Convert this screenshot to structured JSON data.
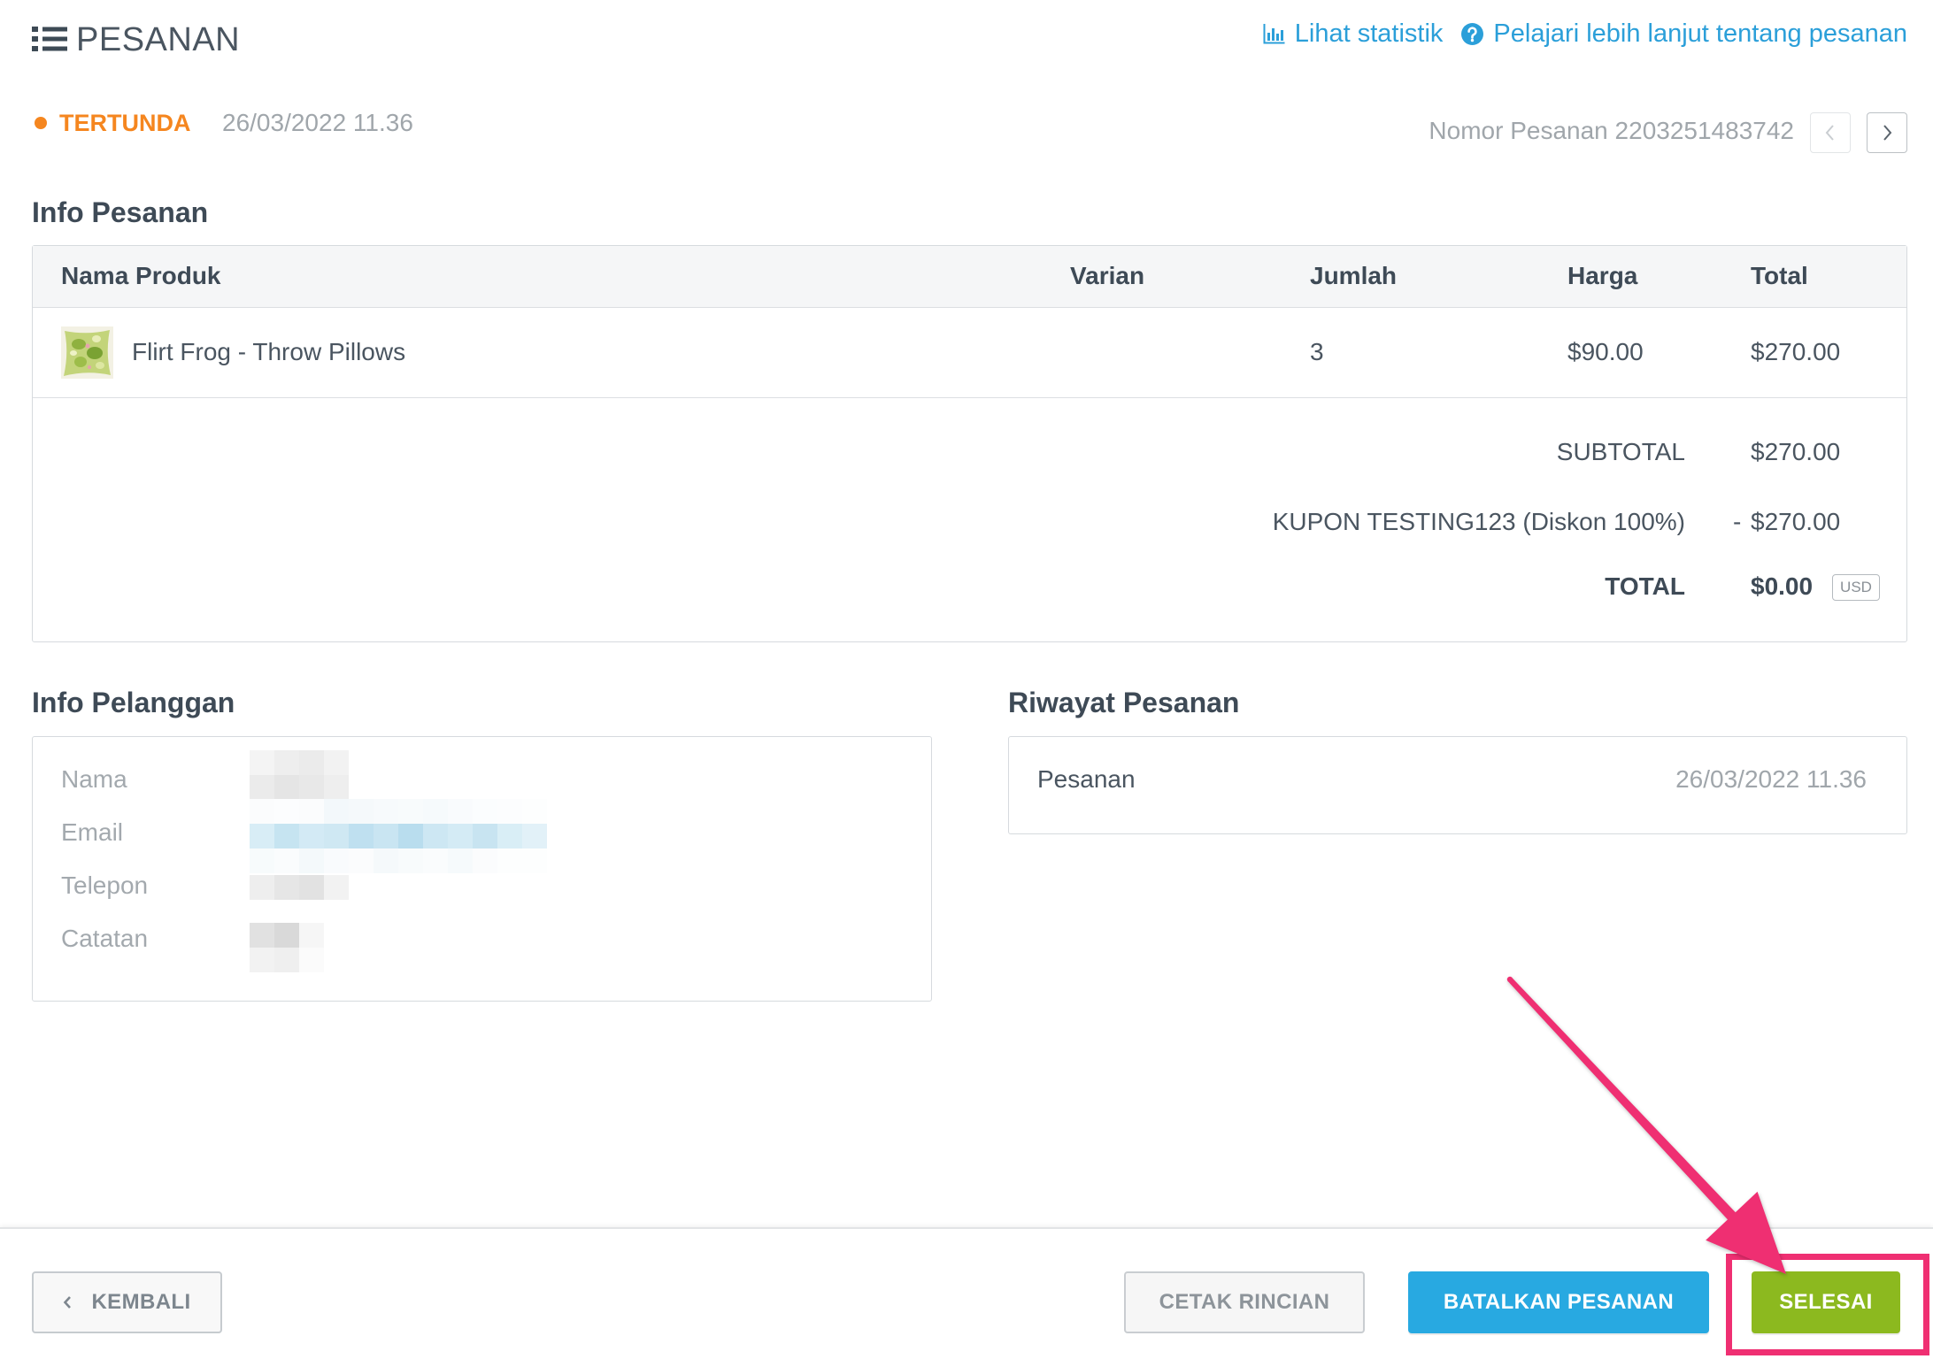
{
  "header": {
    "title": "PESANAN",
    "menu_icon": "list-icon",
    "stats_link": {
      "label": "Lihat statistik",
      "icon": "bar-chart-icon"
    },
    "help_link": {
      "label": "Pelajari lebih lanjut tentang pesanan",
      "icon": "question-circle-icon"
    }
  },
  "status": {
    "label": "TERTUNDA",
    "created_at": "26/03/2022 11.36",
    "order_number_label": "Nomor Pesanan",
    "order_number": "2203251483742",
    "prev_icon": "chevron-left-icon",
    "next_icon": "chevron-right-icon",
    "prev_enabled": false,
    "next_enabled": true
  },
  "order_info": {
    "heading": "Info Pesanan",
    "columns": [
      "Nama Produk",
      "Varian",
      "Jumlah",
      "Harga",
      "Total"
    ],
    "items": [
      {
        "name": "Flirt Frog - Throw Pillows",
        "quantity": "3",
        "price": "$90.00",
        "total": "$270.00"
      }
    ],
    "summary": {
      "subtotal_label": "SUBTOTAL",
      "subtotal_value": "$270.00",
      "coupon_label": "KUPON TESTING123 (Diskon 100%)",
      "coupon_sign": "-",
      "coupon_value": "$270.00",
      "total_label": "TOTAL",
      "total_value": "$0.00",
      "currency": "USD"
    }
  },
  "customer_info": {
    "heading": "Info Pelanggan",
    "labels": [
      "Nama",
      "Email",
      "Telepon",
      "Catatan"
    ]
  },
  "order_history": {
    "heading": "Riwayat Pesanan",
    "entries": [
      {
        "event": "Pesanan",
        "timestamp": "26/03/2022 11.36"
      }
    ]
  },
  "footer": {
    "back_label": "KEMBALI",
    "back_icon": "chevron-left-icon",
    "print_label": "CETAK RINCIAN",
    "cancel_label": "BATALKAN PESANAN",
    "complete_label": "SELESAI"
  },
  "colors": {
    "pending": "#f5861f",
    "link": "#2b9fd9",
    "cancel_button": "#28a9e1",
    "complete_button": "#8cb91f",
    "annotation": "#ef2f72"
  }
}
